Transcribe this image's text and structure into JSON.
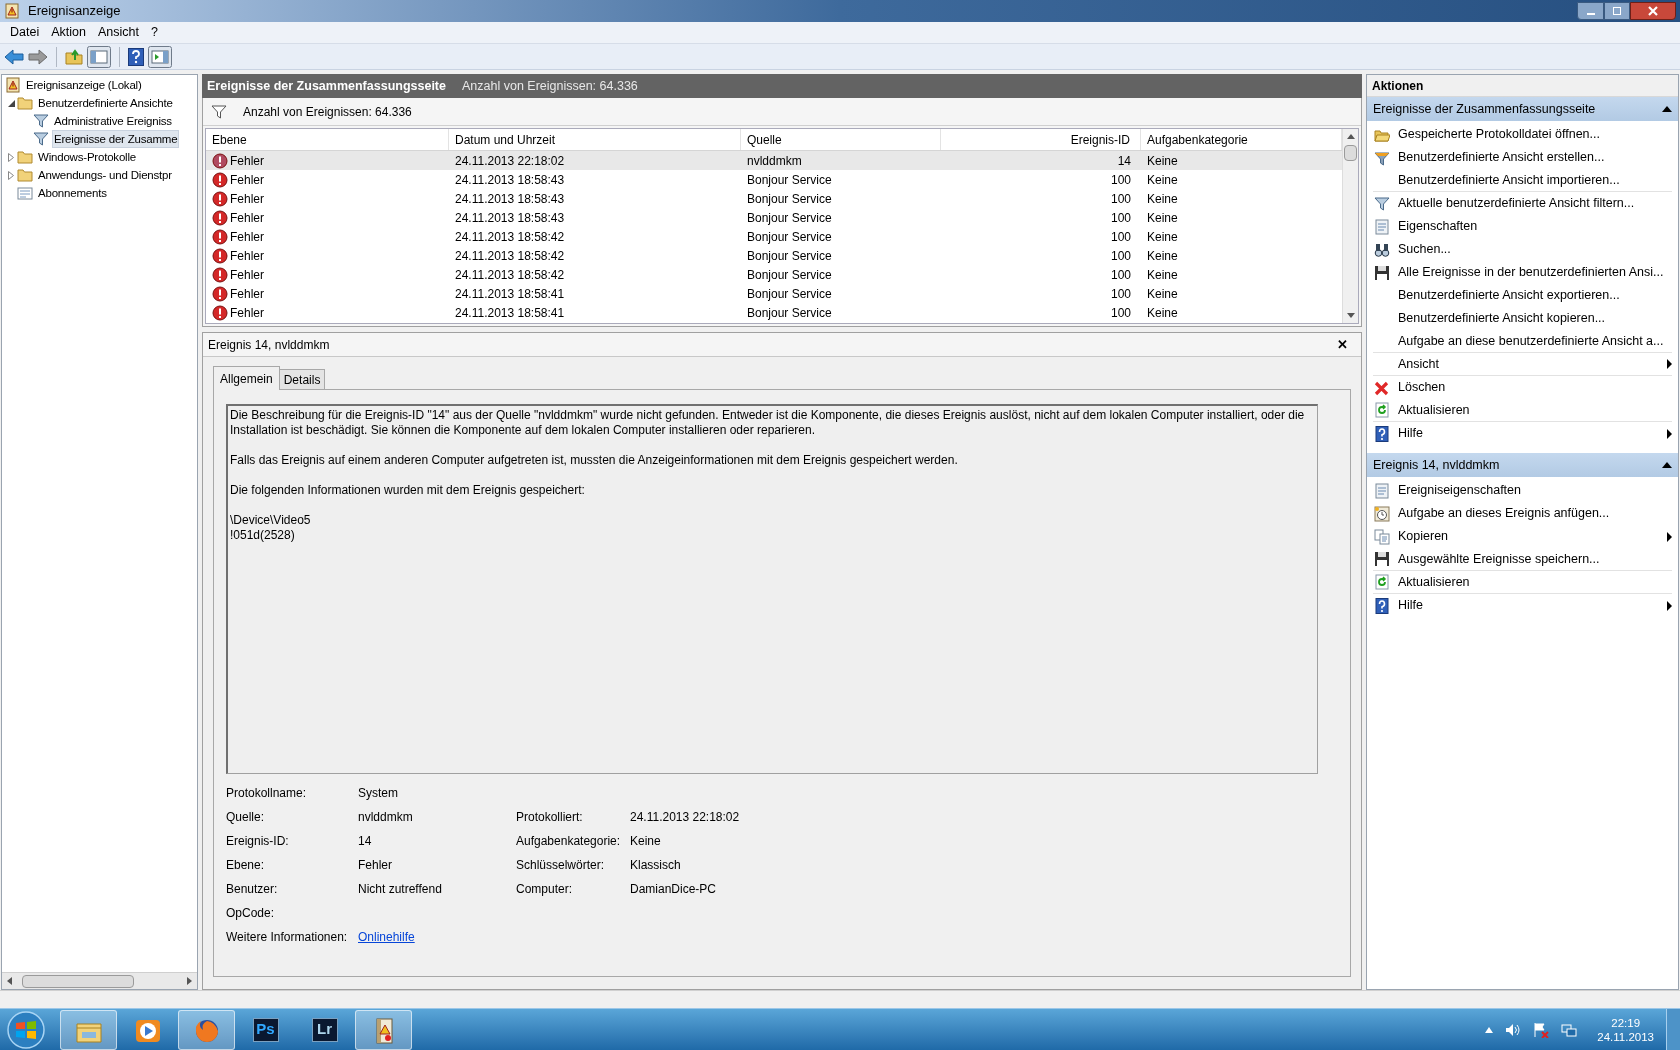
{
  "window": {
    "title": "Ereignisanzeige"
  },
  "menu": [
    "Datei",
    "Aktion",
    "Ansicht",
    "?"
  ],
  "tree": [
    {
      "label": "Ereignisanzeige (Lokal)",
      "kind": "viewer",
      "selected": false,
      "children": [
        {
          "label": "Benutzerdefinierte Ansichte",
          "kind": "folder",
          "selected": false,
          "expanded": true,
          "children": [
            {
              "label": "Administrative Ereigniss",
              "kind": "filter",
              "selected": false
            },
            {
              "label": "Ereignisse der Zusamme",
              "kind": "filter",
              "selected": true
            }
          ]
        },
        {
          "label": "Windows-Protokolle",
          "kind": "folder",
          "selected": false,
          "expanded": false
        },
        {
          "label": "Anwendungs- und Dienstpr",
          "kind": "folder",
          "selected": false,
          "expanded": false
        },
        {
          "label": "Abonnements",
          "kind": "subs",
          "selected": false
        }
      ]
    }
  ],
  "summary": {
    "title": "Ereignisse der Zusammenfassungsseite",
    "count": "Anzahl von Ereignissen: 64.336",
    "filter_text": "Anzahl von Ereignissen: 64.336"
  },
  "table": {
    "columns": [
      "Ebene",
      "Datum und Uhrzeit",
      "Quelle",
      "Ereignis-ID",
      "Aufgabenkategorie"
    ],
    "rows": [
      {
        "level": "Fehler",
        "date": "24.11.2013 22:18:02",
        "source": "nvlddmkm",
        "id": "14",
        "category": "Keine",
        "selected": true
      },
      {
        "level": "Fehler",
        "date": "24.11.2013 18:58:43",
        "source": "Bonjour Service",
        "id": "100",
        "category": "Keine",
        "selected": false
      },
      {
        "level": "Fehler",
        "date": "24.11.2013 18:58:43",
        "source": "Bonjour Service",
        "id": "100",
        "category": "Keine",
        "selected": false
      },
      {
        "level": "Fehler",
        "date": "24.11.2013 18:58:43",
        "source": "Bonjour Service",
        "id": "100",
        "category": "Keine",
        "selected": false
      },
      {
        "level": "Fehler",
        "date": "24.11.2013 18:58:42",
        "source": "Bonjour Service",
        "id": "100",
        "category": "Keine",
        "selected": false
      },
      {
        "level": "Fehler",
        "date": "24.11.2013 18:58:42",
        "source": "Bonjour Service",
        "id": "100",
        "category": "Keine",
        "selected": false
      },
      {
        "level": "Fehler",
        "date": "24.11.2013 18:58:42",
        "source": "Bonjour Service",
        "id": "100",
        "category": "Keine",
        "selected": false
      },
      {
        "level": "Fehler",
        "date": "24.11.2013 18:58:41",
        "source": "Bonjour Service",
        "id": "100",
        "category": "Keine",
        "selected": false
      },
      {
        "level": "Fehler",
        "date": "24.11.2013 18:58:41",
        "source": "Bonjour Service",
        "id": "100",
        "category": "Keine",
        "selected": false
      }
    ]
  },
  "detail": {
    "title": "Ereignis 14, nvlddmkm",
    "close": "✕",
    "tabs": [
      {
        "label": "Allgemein",
        "selected": true
      },
      {
        "label": "Details",
        "selected": false
      }
    ],
    "description": [
      "Die Beschreibung für die Ereignis-ID \"14\" aus der Quelle \"nvlddmkm\" wurde nicht gefunden. Entweder ist die Komponente, die dieses Ereignis auslöst, nicht auf dem lokalen Computer installiert, oder die Installation ist beschädigt. Sie können die Komponente auf dem lokalen Computer installieren oder reparieren.",
      "Falls das Ereignis auf einem anderen Computer aufgetreten ist, mussten die Anzeigeinformationen mit dem Ereignis gespeichert werden.",
      "Die folgenden Informationen wurden mit dem Ereignis gespeichert:",
      "\\Device\\Video5\n!051d(2528)"
    ],
    "fields": [
      {
        "left": {
          "label": "Protokollname:",
          "value": "System"
        }
      },
      {
        "left": {
          "label": "Quelle:",
          "value": "nvlddmkm"
        },
        "right": {
          "label": "Protokolliert:",
          "value": "24.11.2013 22:18:02"
        }
      },
      {
        "left": {
          "label": "Ereignis-ID:",
          "value": "14"
        },
        "right": {
          "label": "Aufgabenkategorie:",
          "value": "Keine"
        }
      },
      {
        "left": {
          "label": "Ebene:",
          "value": "Fehler"
        },
        "right": {
          "label": "Schlüsselwörter:",
          "value": "Klassisch"
        }
      },
      {
        "left": {
          "label": "Benutzer:",
          "value": "Nicht zutreffend"
        },
        "right": {
          "label": "Computer:",
          "value": "DamianDice-PC"
        }
      },
      {
        "left": {
          "label": "OpCode:"
        }
      },
      {
        "left": {
          "label": "Weitere Informationen:",
          "value": "Onlinehilfe",
          "kind": "link"
        }
      }
    ]
  },
  "actions": {
    "title": "Aktionen",
    "sections": [
      {
        "title": "Ereignisse der Zusammenfassungsseite",
        "items": [
          {
            "label": "Gespeicherte Protokolldatei öffnen...",
            "kind": "open"
          },
          {
            "label": "Benutzerdefinierte Ansicht erstellen...",
            "kind": "filter-new"
          },
          {
            "label": "Benutzerdefinierte Ansicht importieren...",
            "divider_after": true
          },
          {
            "label": "Aktuelle benutzerdefinierte Ansicht filtern...",
            "kind": "filter"
          },
          {
            "label": "Eigenschaften",
            "kind": "props"
          },
          {
            "label": "Suchen...",
            "kind": "find"
          },
          {
            "label": "Alle Ereignisse in der benutzerdefinierten Ansi...",
            "kind": "save"
          },
          {
            "label": "Benutzerdefinierte Ansicht exportieren..."
          },
          {
            "label": "Benutzerdefinierte Ansicht kopieren..."
          },
          {
            "label": "Aufgabe an diese benutzerdefinierte Ansicht a...",
            "divider_after": true
          },
          {
            "label": "Ansicht",
            "submenu": true,
            "divider_after": true
          },
          {
            "label": "Löschen",
            "kind": "delete"
          },
          {
            "label": "Aktualisieren",
            "kind": "refresh",
            "divider_after": true
          },
          {
            "label": "Hilfe",
            "kind": "help",
            "submenu": true
          }
        ]
      },
      {
        "title": "Ereignis 14, nvlddmkm",
        "items": [
          {
            "label": "Ereigniseigenschaften",
            "kind": "props"
          },
          {
            "label": "Aufgabe an dieses Ereignis anfügen...",
            "kind": "task"
          },
          {
            "label": "Kopieren",
            "kind": "copy",
            "submenu": true
          },
          {
            "label": "Ausgewählte Ereignisse speichern...",
            "kind": "save",
            "divider_after": true
          },
          {
            "label": "Aktualisieren",
            "kind": "refresh",
            "divider_after": true
          },
          {
            "label": "Hilfe",
            "kind": "help",
            "submenu": true
          }
        ]
      }
    ]
  },
  "taskbar": {
    "apps": [
      {
        "kind": "explorer",
        "running": true
      },
      {
        "kind": "media",
        "running": false
      },
      {
        "kind": "firefox",
        "running": true
      },
      {
        "kind": "text",
        "text": "Ps",
        "color": "#31a8ff",
        "running": false
      },
      {
        "kind": "text",
        "text": "Lr",
        "color": "#add5ec",
        "running": false
      },
      {
        "kind": "viewer",
        "running": true
      }
    ],
    "time": "22:19",
    "date": "24.11.2013"
  }
}
